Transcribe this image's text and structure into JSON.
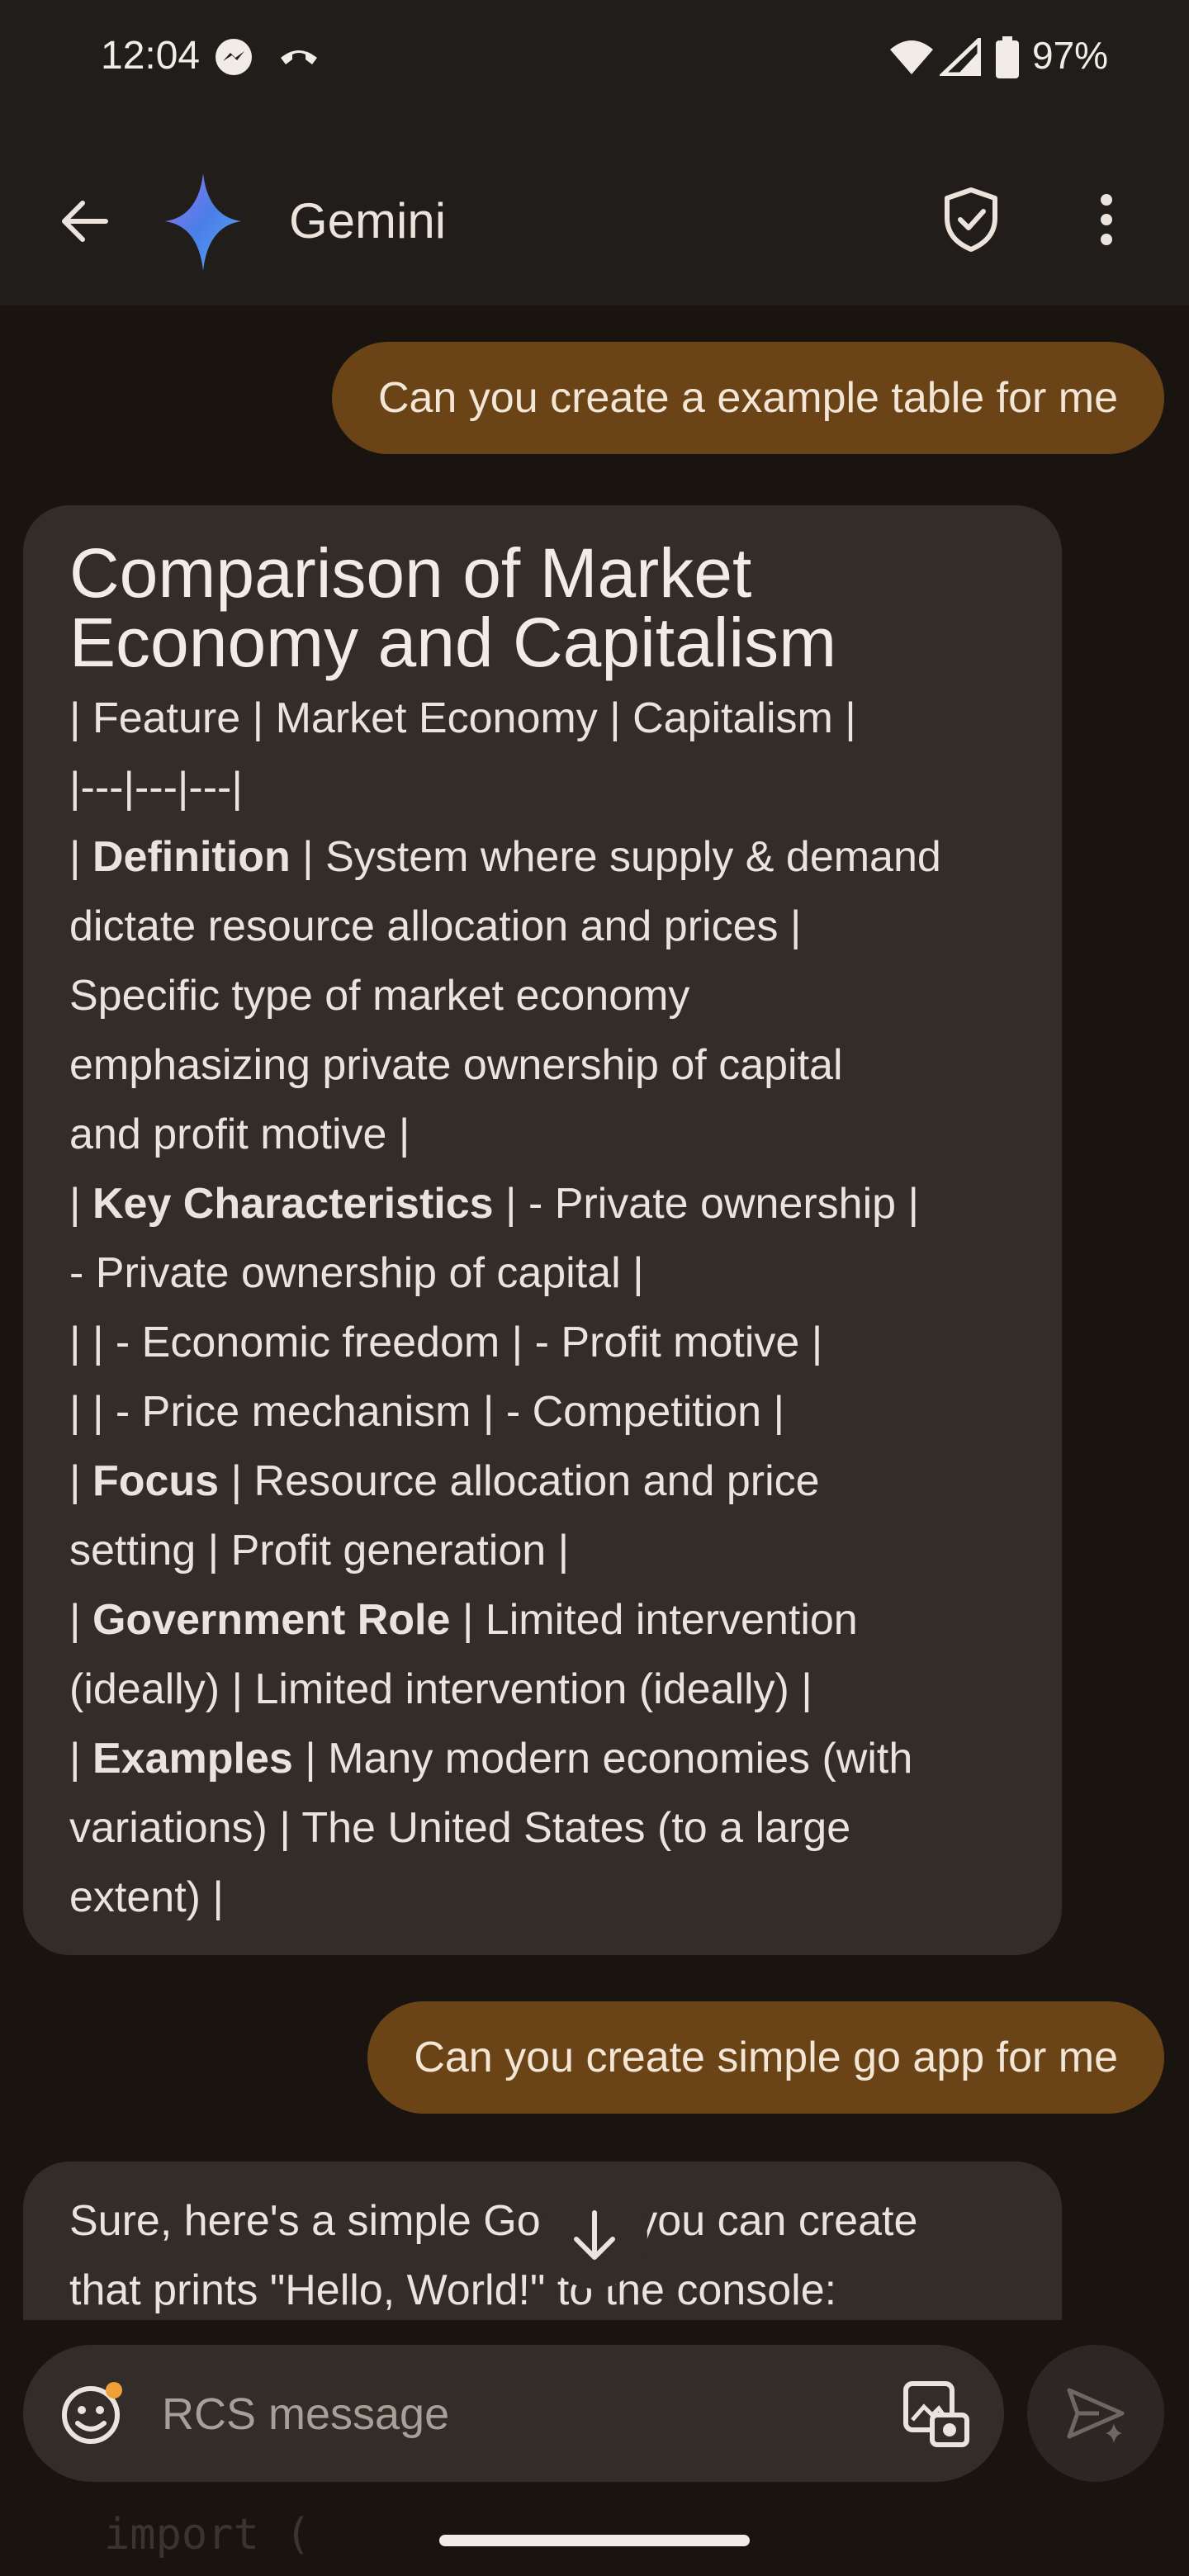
{
  "status": {
    "time": "12:04",
    "battery": "97%"
  },
  "header": {
    "title": "Gemini"
  },
  "messages": {
    "user1": "Can you create a example table for me",
    "bot1": {
      "title": "Comparison of Market Economy and Capitalism",
      "title_line1": "Comparison of Market",
      "title_line2": "Economy and Capitalism",
      "lines": [
        "| Feature | Market Economy | Capitalism |",
        "|---|---|---|",
        {
          "bold": "Definition",
          "text": " | System where supply & demand"
        },
        "dictate resource allocation and prices |",
        "Specific type of market economy",
        "emphasizing private ownership of capital",
        "and profit motive |",
        {
          "bold": "Key Characteristics",
          "text": " | - Private ownership  |"
        },
        "- Private ownership of capital |",
        "| | - Economic freedom | - Profit motive |",
        "| | - Price mechanism | - Competition |",
        {
          "bold": "Focus",
          "text": " |  Resource allocation and price"
        },
        "setting |  Profit generation |",
        {
          "bold": "Government Role",
          "text": " | Limited intervention"
        },
        "(ideally) | Limited intervention (ideally) |",
        {
          "bold": "Examples",
          "text": " | Many modern economies (with"
        },
        "variations) | The United States (to a large",
        "extent) |"
      ]
    },
    "user2": "Can you create simple go app for me",
    "bot2": {
      "line1": "Sure, here's a simple Go app you can create",
      "line2": "that prints \"Hello, World!\" to the console:"
    }
  },
  "composer": {
    "placeholder": "RCS message"
  },
  "code_peek": "import ("
}
